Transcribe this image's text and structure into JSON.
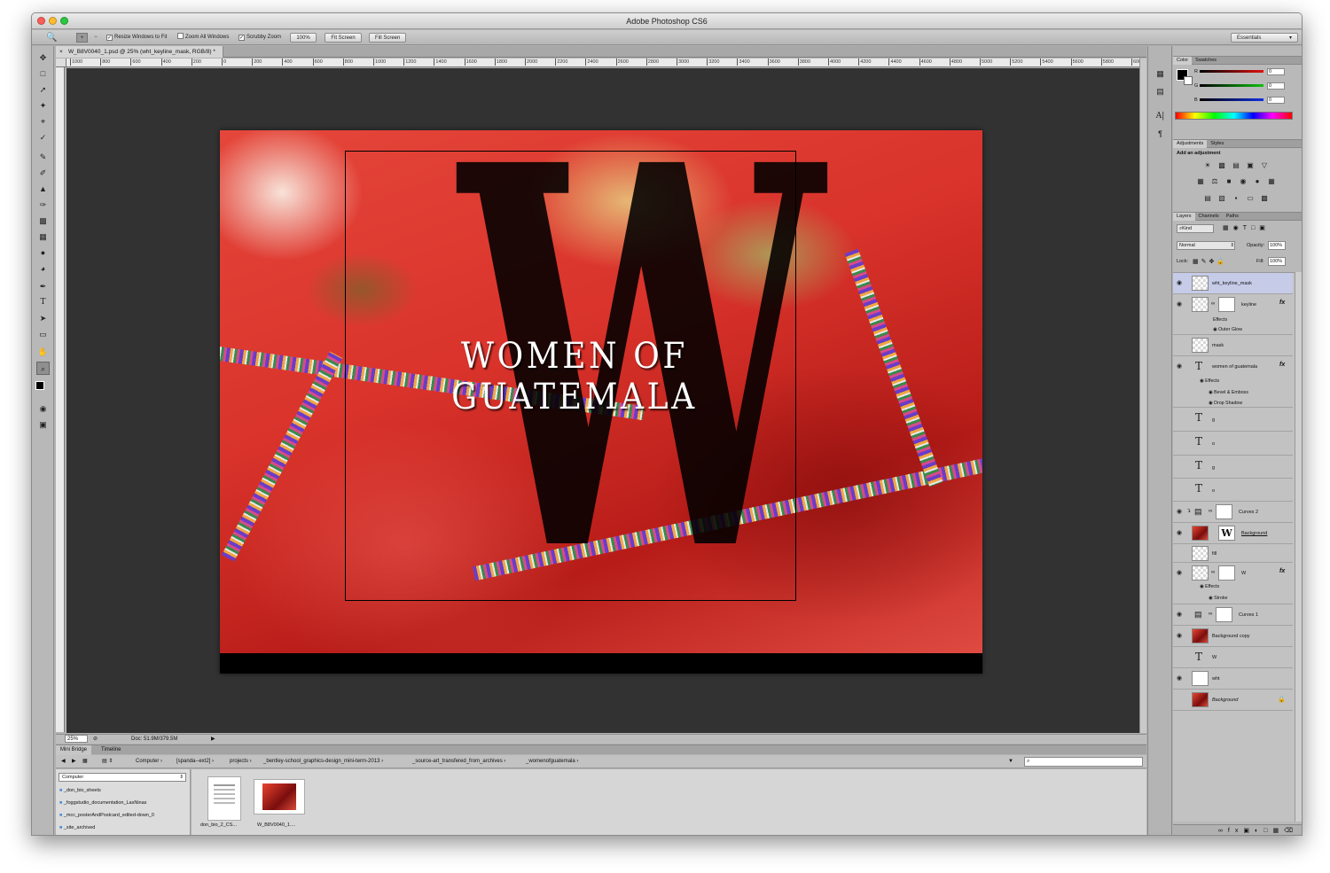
{
  "window": {
    "title": "Adobe Photoshop CS6"
  },
  "options_bar": {
    "resize_windows": "Resize Windows to Fit",
    "zoom_all": "Zoom All Windows",
    "scrubby": "Scrubby Zoom",
    "btn_100": "100%",
    "btn_fit": "Fit Screen",
    "btn_fill": "Fill Screen",
    "workspace": "Essentials"
  },
  "document": {
    "tab_title": "W_B8V0040_1.psd @ 25% (wht_keyline_mask, RGB/8) *",
    "zoom": "25%",
    "doc_size": "Doc: 51.9M/379.5M",
    "ruler_labels": [
      "1000",
      "800",
      "600",
      "400",
      "200",
      "0",
      "200",
      "400",
      "600",
      "800",
      "1000",
      "1200",
      "1400",
      "1600",
      "1800",
      "2000",
      "2200",
      "2400",
      "2600",
      "2800",
      "3000",
      "3200",
      "3400",
      "3600",
      "3800",
      "4000",
      "4200",
      "4400",
      "4600",
      "4800",
      "5000",
      "5200",
      "5400",
      "5600",
      "5800",
      "600"
    ]
  },
  "artwork": {
    "letter": "W",
    "title_text": "WOMEN OF GUATEMALA"
  },
  "mini_bridge": {
    "tabs": [
      "Mini Bridge",
      "Timeline"
    ],
    "path": [
      "Computer",
      "[spanda--ext2]",
      "projects",
      "_bentley-school_graphics-design_mini-term-2013",
      "_source-art_transfered_from_archives",
      "_womenofguatemala"
    ],
    "location": "Computer",
    "folders": [
      "_don_bio_sheets",
      "_foggstudio_documentation_LasNinas",
      "_mcc_posterAndPostcard_edited-down_0",
      "_site_archived"
    ],
    "files": [
      "don_bio_2_CS...",
      "W_B8V0040_1...."
    ]
  },
  "color_panel": {
    "tabs": [
      "Color",
      "Swatches"
    ],
    "labels": [
      "R",
      "G",
      "B"
    ],
    "values": [
      "0",
      "0",
      "0"
    ],
    "colors": {
      "red": "#e01010",
      "green": "#10c010",
      "blue": "#1030e0"
    }
  },
  "adjustments_panel": {
    "tabs": [
      "Adjustments",
      "Styles"
    ],
    "add_label": "Add an adjustment"
  },
  "layers_panel": {
    "tabs": [
      "Layers",
      "Channels",
      "Paths"
    ],
    "kind": "Kind",
    "blend_mode": "Normal",
    "opacity_label": "Opacity:",
    "opacity": "100%",
    "lock_label": "Lock:",
    "fill_label": "Fill:",
    "fill": "100%",
    "layers": [
      {
        "name": "wht_keyline_mask"
      },
      {
        "name": "keyline",
        "effects_label": "Effects",
        "effects": [
          "Outer Glow"
        ]
      },
      {
        "name": "mask"
      },
      {
        "name": "women of guatemala",
        "effects_label": "Effects",
        "effects": [
          "Bevel & Emboss",
          "Drop Shadow"
        ]
      },
      {
        "name": "g"
      },
      {
        "name": "o"
      },
      {
        "name": "g"
      },
      {
        "name": "o"
      },
      {
        "name": "Curves 2"
      },
      {
        "name": "Background"
      },
      {
        "name": "fill"
      },
      {
        "name": "W",
        "effects_label": "Effects",
        "effects": [
          "Stroke"
        ]
      },
      {
        "name": "Curves 1"
      },
      {
        "name": "Background copy"
      },
      {
        "name": "W"
      },
      {
        "name": "wht"
      },
      {
        "name": "Background"
      }
    ]
  }
}
